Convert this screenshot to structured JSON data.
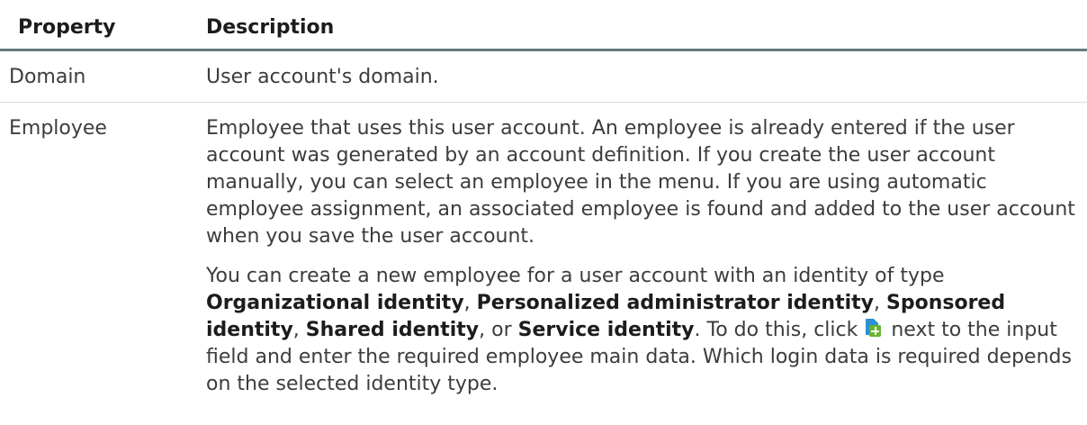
{
  "table": {
    "headers": {
      "property": "Property",
      "description": "Description"
    },
    "rows": [
      {
        "property": "Domain",
        "description": "User account's domain."
      },
      {
        "property": "Employee",
        "description_p1": "Employee that uses this user account. An employee is already entered if the user account was generated by an account definition. If you create the user account manually, you can select an employee in the menu. If you are using automatic employee assignment, an associated employee is found and added to the user account when you save the user account.",
        "description_p2": {
          "intro": "You can create a new employee for a user account with an identity of type ",
          "identity_types": [
            "Organizational identity",
            "Personalized administrator identity",
            "Sponsored identity",
            "Shared identity",
            "Service identity"
          ],
          "sep1": ", ",
          "sep2": ", ",
          "sep3": ", ",
          "sep4": ", or ",
          "after_types": ". To do this, click ",
          "icon": "add-new-employee-icon",
          "after_icon": " next to the input field and enter the required employee main data. Which login data is required depends on the selected identity type."
        }
      }
    ]
  }
}
